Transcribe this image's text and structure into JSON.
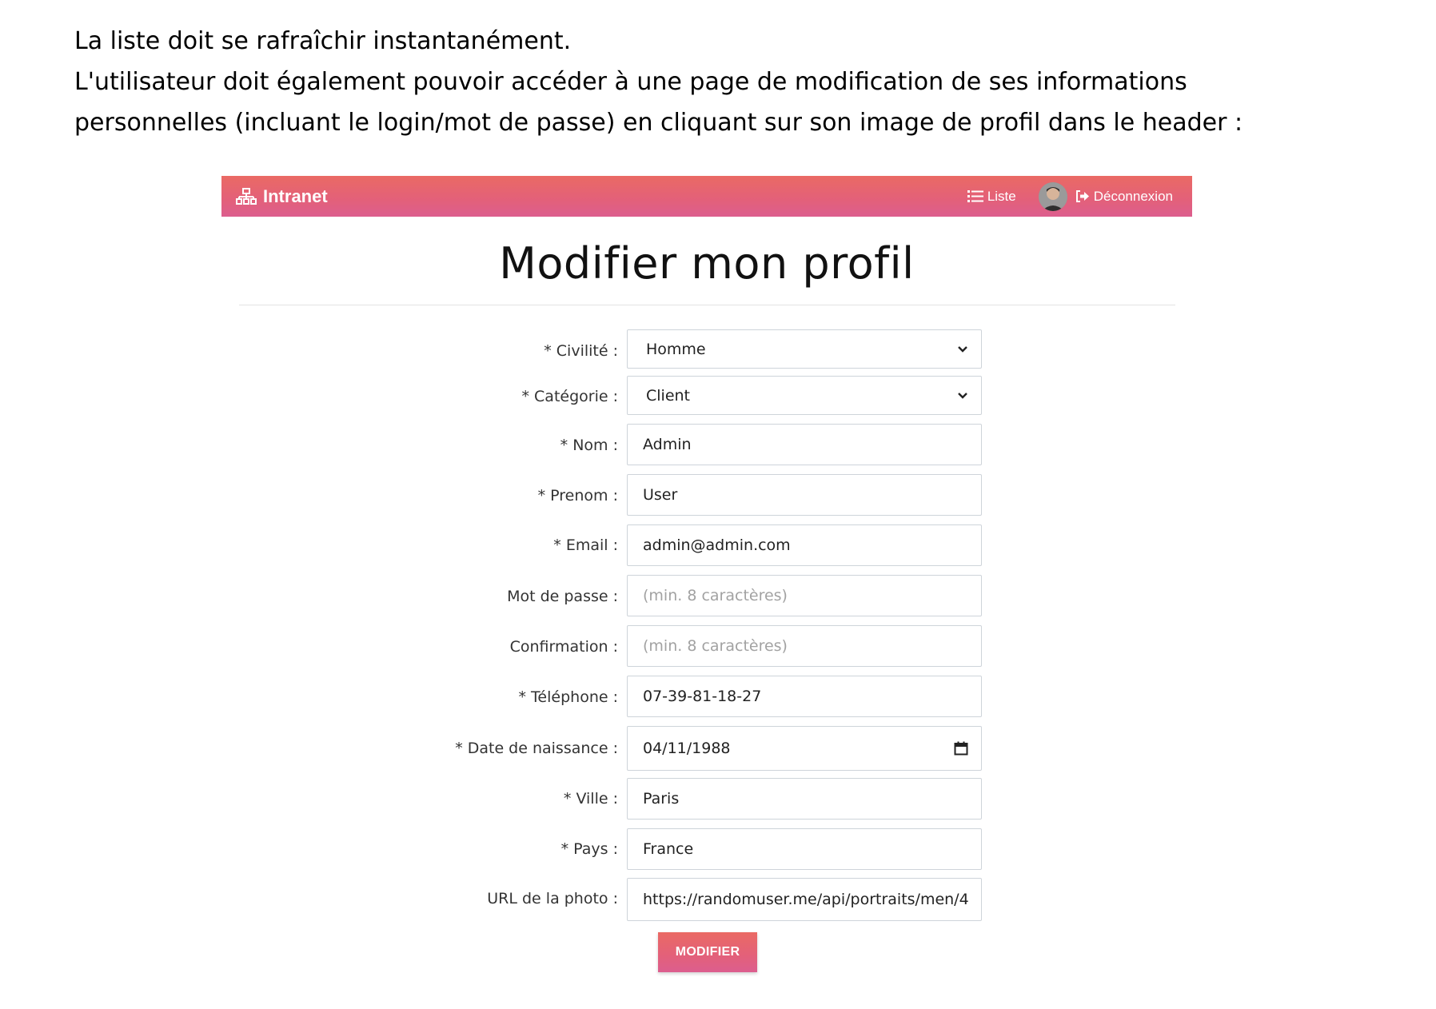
{
  "document": {
    "paragraph_1": "La liste doit se rafraîchir instantanément.",
    "paragraph_2_line_1": "L'utilisateur doit également pouvoir accéder à une page de modification de ses informations",
    "paragraph_2_line_2": "personnelles (incluant le login/mot de passe) en cliquant sur son image de profil dans le header :"
  },
  "navbar": {
    "brand": "Intranet",
    "brand_icon": "sitemap-icon",
    "list_link": "Liste",
    "list_icon": "list-icon",
    "logout_link": "Déconnexion",
    "logout_icon": "sign-out-icon",
    "avatar_icon": "avatar",
    "accent_color": "#e3607a"
  },
  "page": {
    "title": "Modifier mon profil",
    "submit_label": "MODIFIER"
  },
  "form": {
    "civilite": {
      "label": "* Civilité :",
      "value": "Homme"
    },
    "categorie": {
      "label": "* Catégorie :",
      "value": "Client"
    },
    "nom": {
      "label": "* Nom :",
      "value": "Admin"
    },
    "prenom": {
      "label": "* Prenom :",
      "value": "User"
    },
    "email": {
      "label": "* Email :",
      "value": "admin@admin.com"
    },
    "password": {
      "label": "Mot de passe :",
      "placeholder": "(min. 8 caractères)"
    },
    "confirmation": {
      "label": "Confirmation :",
      "placeholder": "(min. 8 caractères)"
    },
    "telephone": {
      "label": "* Téléphone :",
      "value": "07-39-81-18-27"
    },
    "naissance": {
      "label": "* Date de naissance :",
      "value": "04/11/1988"
    },
    "ville": {
      "label": "* Ville :",
      "value": "Paris"
    },
    "pays": {
      "label": "* Pays :",
      "value": "France"
    },
    "photo": {
      "label": "URL de la photo :",
      "value": "https://randomuser.me/api/portraits/men/4:"
    }
  }
}
